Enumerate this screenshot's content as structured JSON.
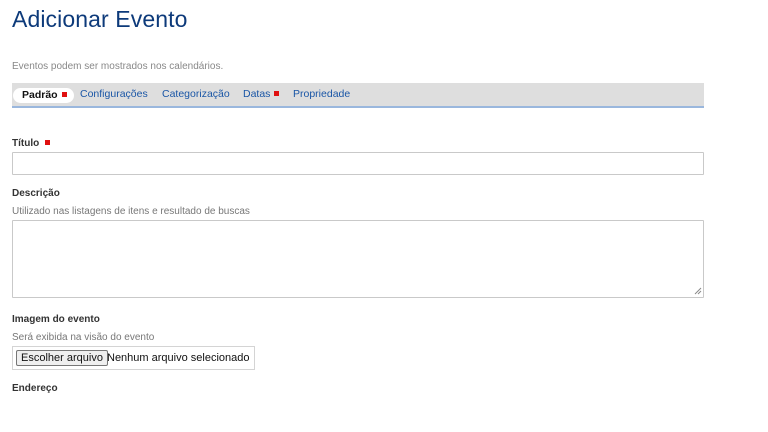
{
  "page": {
    "title": "Adicionar Evento",
    "description": "Eventos podem ser mostrados nos calendários."
  },
  "tabs": [
    {
      "label": "Padrão",
      "required": true,
      "active": true
    },
    {
      "label": "Configurações",
      "required": false,
      "active": false
    },
    {
      "label": "Categorização",
      "required": false,
      "active": false
    },
    {
      "label": "Datas",
      "required": true,
      "active": false
    },
    {
      "label": "Propriedade",
      "required": false,
      "active": false
    }
  ],
  "form": {
    "title_field": {
      "label": "Título",
      "required": true,
      "value": ""
    },
    "description_field": {
      "label": "Descrição",
      "help": "Utilizado nas listagens de itens e resultado de buscas",
      "value": ""
    },
    "image_field": {
      "label": "Imagem do evento",
      "help": "Será exibida na visão do evento",
      "button_label": "Escolher arquivo",
      "status": "Nenhum arquivo selecionado"
    },
    "address_field": {
      "label": "Endereço"
    }
  },
  "colors": {
    "title": "#0d3a7a",
    "tab_link": "#1a56a6",
    "required_marker": "#e01010",
    "tab_underline": "#9ab7dd"
  }
}
